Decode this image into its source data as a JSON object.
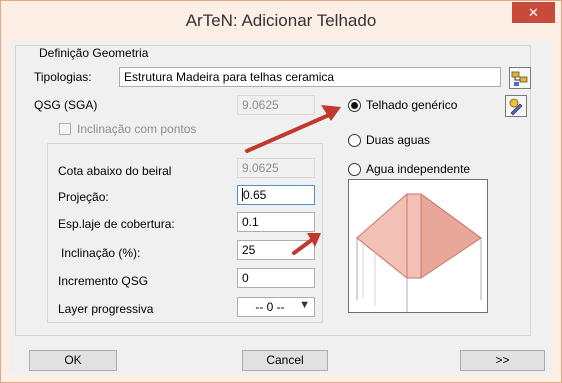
{
  "window": {
    "title": "ArTeN: Adicionar Telhado",
    "close_glyph": "✕"
  },
  "group": {
    "label": "Definição Geometria"
  },
  "tipologias": {
    "label": "Tipologias:",
    "value": "Estrutura Madeira para telhas ceramica"
  },
  "qsg": {
    "label": "QSG (SGA)",
    "value": "9.0625"
  },
  "inclinacao_pontos": {
    "label": "Inclinação com pontos",
    "checked": false
  },
  "fields": {
    "cota": {
      "label": "Cota abaixo do beiral",
      "value": "9.0625"
    },
    "projecao": {
      "label": "Projeção:",
      "value": "0.65"
    },
    "esp_laje": {
      "label": "Esp.laje de cobertura:",
      "value": "0.1"
    },
    "inclinacao": {
      "label": "Inclinação (%):",
      "value": "25"
    },
    "incremento": {
      "label": "Incremento QSG",
      "value": "0"
    },
    "layer": {
      "label": "Layer progressiva",
      "value": "-- 0 --"
    }
  },
  "roof_types": [
    {
      "label": "Telhado genérico",
      "selected": true
    },
    {
      "label": "Duas aguas",
      "selected": false
    },
    {
      "label": "Agua independente",
      "selected": false
    }
  ],
  "buttons": {
    "ok": "OK",
    "cancel": "Cancel",
    "next": ">>"
  },
  "colors": {
    "title_border": "#e6a583",
    "close_button": "#c74a3a",
    "annotation_arrow": "#c0392b",
    "roof_fill": "#e9a79a",
    "roof_edge": "#c97a6c"
  },
  "icons": {
    "tipologias_button": "folder-tree-icon",
    "edit_button": "pencil-config-icon"
  }
}
